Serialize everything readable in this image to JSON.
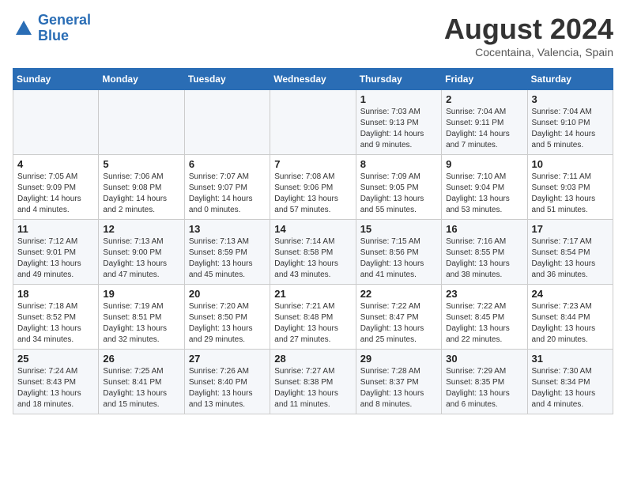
{
  "logo": {
    "line1": "General",
    "line2": "Blue"
  },
  "title": "August 2024",
  "subtitle": "Cocentaina, Valencia, Spain",
  "weekdays": [
    "Sunday",
    "Monday",
    "Tuesday",
    "Wednesday",
    "Thursday",
    "Friday",
    "Saturday"
  ],
  "weeks": [
    [
      {
        "day": "",
        "info": ""
      },
      {
        "day": "",
        "info": ""
      },
      {
        "day": "",
        "info": ""
      },
      {
        "day": "",
        "info": ""
      },
      {
        "day": "1",
        "info": "Sunrise: 7:03 AM\nSunset: 9:13 PM\nDaylight: 14 hours\nand 9 minutes."
      },
      {
        "day": "2",
        "info": "Sunrise: 7:04 AM\nSunset: 9:11 PM\nDaylight: 14 hours\nand 7 minutes."
      },
      {
        "day": "3",
        "info": "Sunrise: 7:04 AM\nSunset: 9:10 PM\nDaylight: 14 hours\nand 5 minutes."
      }
    ],
    [
      {
        "day": "4",
        "info": "Sunrise: 7:05 AM\nSunset: 9:09 PM\nDaylight: 14 hours\nand 4 minutes."
      },
      {
        "day": "5",
        "info": "Sunrise: 7:06 AM\nSunset: 9:08 PM\nDaylight: 14 hours\nand 2 minutes."
      },
      {
        "day": "6",
        "info": "Sunrise: 7:07 AM\nSunset: 9:07 PM\nDaylight: 14 hours\nand 0 minutes."
      },
      {
        "day": "7",
        "info": "Sunrise: 7:08 AM\nSunset: 9:06 PM\nDaylight: 13 hours\nand 57 minutes."
      },
      {
        "day": "8",
        "info": "Sunrise: 7:09 AM\nSunset: 9:05 PM\nDaylight: 13 hours\nand 55 minutes."
      },
      {
        "day": "9",
        "info": "Sunrise: 7:10 AM\nSunset: 9:04 PM\nDaylight: 13 hours\nand 53 minutes."
      },
      {
        "day": "10",
        "info": "Sunrise: 7:11 AM\nSunset: 9:03 PM\nDaylight: 13 hours\nand 51 minutes."
      }
    ],
    [
      {
        "day": "11",
        "info": "Sunrise: 7:12 AM\nSunset: 9:01 PM\nDaylight: 13 hours\nand 49 minutes."
      },
      {
        "day": "12",
        "info": "Sunrise: 7:13 AM\nSunset: 9:00 PM\nDaylight: 13 hours\nand 47 minutes."
      },
      {
        "day": "13",
        "info": "Sunrise: 7:13 AM\nSunset: 8:59 PM\nDaylight: 13 hours\nand 45 minutes."
      },
      {
        "day": "14",
        "info": "Sunrise: 7:14 AM\nSunset: 8:58 PM\nDaylight: 13 hours\nand 43 minutes."
      },
      {
        "day": "15",
        "info": "Sunrise: 7:15 AM\nSunset: 8:56 PM\nDaylight: 13 hours\nand 41 minutes."
      },
      {
        "day": "16",
        "info": "Sunrise: 7:16 AM\nSunset: 8:55 PM\nDaylight: 13 hours\nand 38 minutes."
      },
      {
        "day": "17",
        "info": "Sunrise: 7:17 AM\nSunset: 8:54 PM\nDaylight: 13 hours\nand 36 minutes."
      }
    ],
    [
      {
        "day": "18",
        "info": "Sunrise: 7:18 AM\nSunset: 8:52 PM\nDaylight: 13 hours\nand 34 minutes."
      },
      {
        "day": "19",
        "info": "Sunrise: 7:19 AM\nSunset: 8:51 PM\nDaylight: 13 hours\nand 32 minutes."
      },
      {
        "day": "20",
        "info": "Sunrise: 7:20 AM\nSunset: 8:50 PM\nDaylight: 13 hours\nand 29 minutes."
      },
      {
        "day": "21",
        "info": "Sunrise: 7:21 AM\nSunset: 8:48 PM\nDaylight: 13 hours\nand 27 minutes."
      },
      {
        "day": "22",
        "info": "Sunrise: 7:22 AM\nSunset: 8:47 PM\nDaylight: 13 hours\nand 25 minutes."
      },
      {
        "day": "23",
        "info": "Sunrise: 7:22 AM\nSunset: 8:45 PM\nDaylight: 13 hours\nand 22 minutes."
      },
      {
        "day": "24",
        "info": "Sunrise: 7:23 AM\nSunset: 8:44 PM\nDaylight: 13 hours\nand 20 minutes."
      }
    ],
    [
      {
        "day": "25",
        "info": "Sunrise: 7:24 AM\nSunset: 8:43 PM\nDaylight: 13 hours\nand 18 minutes."
      },
      {
        "day": "26",
        "info": "Sunrise: 7:25 AM\nSunset: 8:41 PM\nDaylight: 13 hours\nand 15 minutes."
      },
      {
        "day": "27",
        "info": "Sunrise: 7:26 AM\nSunset: 8:40 PM\nDaylight: 13 hours\nand 13 minutes."
      },
      {
        "day": "28",
        "info": "Sunrise: 7:27 AM\nSunset: 8:38 PM\nDaylight: 13 hours\nand 11 minutes."
      },
      {
        "day": "29",
        "info": "Sunrise: 7:28 AM\nSunset: 8:37 PM\nDaylight: 13 hours\nand 8 minutes."
      },
      {
        "day": "30",
        "info": "Sunrise: 7:29 AM\nSunset: 8:35 PM\nDaylight: 13 hours\nand 6 minutes."
      },
      {
        "day": "31",
        "info": "Sunrise: 7:30 AM\nSunset: 8:34 PM\nDaylight: 13 hours\nand 4 minutes."
      }
    ]
  ]
}
